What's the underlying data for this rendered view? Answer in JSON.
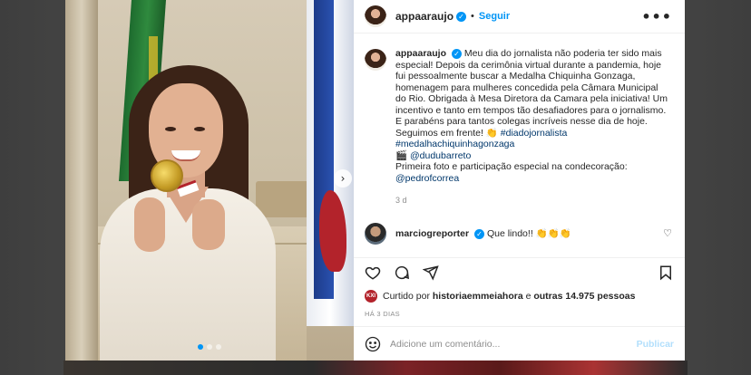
{
  "post": {
    "author": "appaaraujo",
    "separator": "•",
    "follow_label": "Seguir",
    "more_label": "•••"
  },
  "caption": {
    "username": "appaaraujo",
    "text": "Meu dia do jornalista não poderia ter sido mais especial! Depois da cerimônia virtual durante a pandemia, hoje fui pessoalmente buscar a Medalha Chiquinha Gonzaga, homenagem para mulheres concedida pela Câmara Municipal do Rio. Obrigada à Mesa Diretora da Camara pela iniciativa! Um incentivo e tanto em tempos tão desafiadores para o jornalismo.",
    "line2": "E parabéns para tantos colegas incríveis nesse dia de hoje.",
    "line3": "Seguimos em frente! 👏",
    "hashtag1": "#diadojornalista",
    "hashtag2": "#medalhachiquinhagonzaga",
    "camera_prefix": "🎬",
    "credit_user": "@dudubarreto",
    "line_photo": "Primeira foto e participação especial na condecoração:",
    "credit_user2": "@pedrofcorrea",
    "time": "3 d"
  },
  "comment": {
    "username": "marciogreporter",
    "text": "Que lindo!! 👏👏👏"
  },
  "likes": {
    "avatar_text": "KXI",
    "prefix": "Curtido por",
    "user": "historiaemmeiahora",
    "middle": "e",
    "others": "outras 14.975 pessoas"
  },
  "date": "HÁ 3 DIAS",
  "add_comment": {
    "placeholder": "Adicione um comentário...",
    "publish_label": "Publicar"
  },
  "carousel": {
    "next_glyph": "›",
    "slide_count": 3,
    "active_index": 0
  },
  "colors": {
    "accent": "#0095f6",
    "text": "#262626",
    "muted": "#8e8e8e"
  }
}
